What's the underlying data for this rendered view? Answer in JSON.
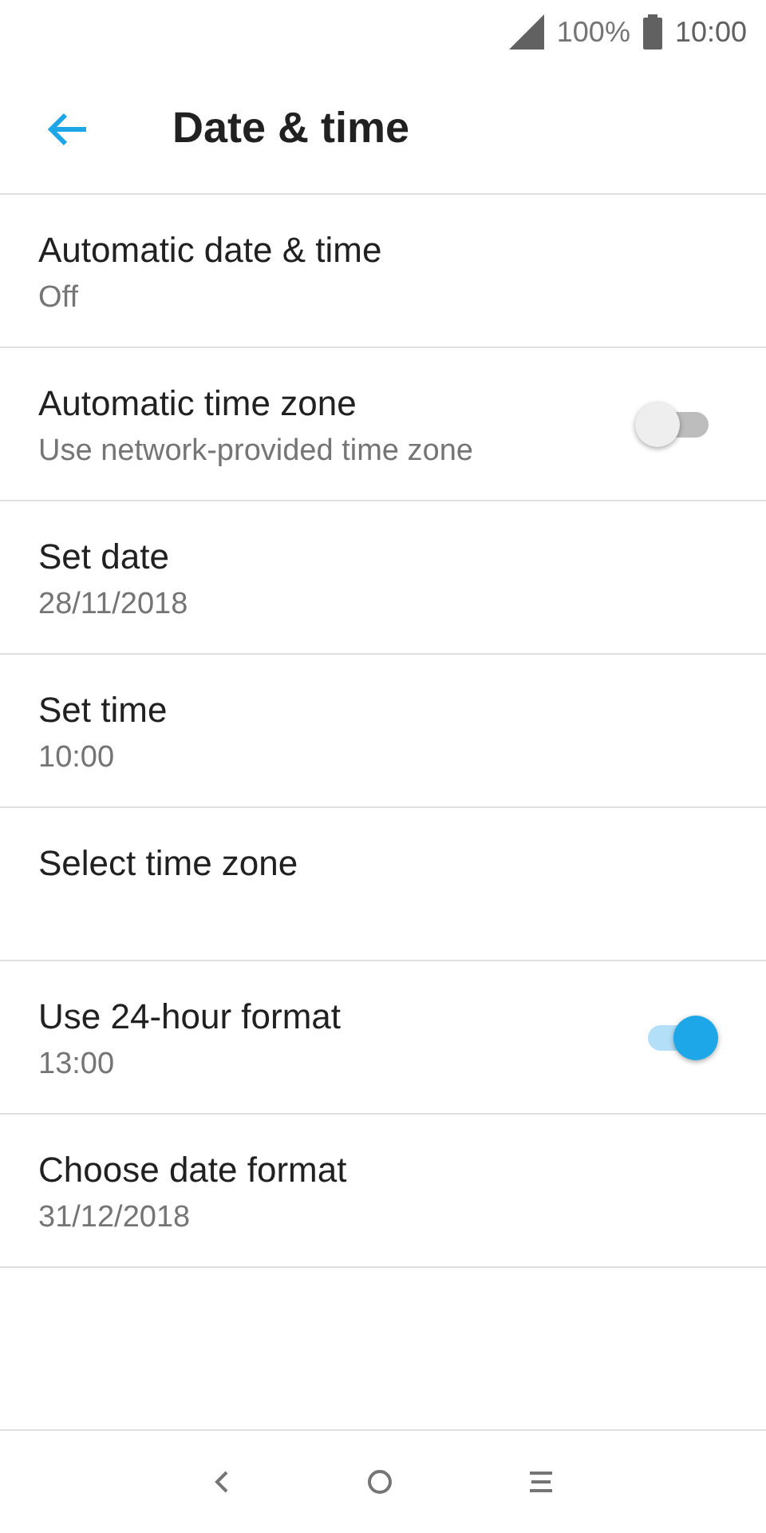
{
  "status_bar": {
    "battery": "100%",
    "time": "10:00"
  },
  "app_bar": {
    "title": "Date & time"
  },
  "settings": [
    {
      "kind": "plain",
      "title": "Automatic date & time",
      "summary": "Off"
    },
    {
      "kind": "switch",
      "title": "Automatic time zone",
      "summary": "Use network-provided time zone",
      "on": false
    },
    {
      "kind": "plain",
      "title": "Set date",
      "summary": "28/11/2018"
    },
    {
      "kind": "plain",
      "title": "Set time",
      "summary": "10:00"
    },
    {
      "kind": "plain",
      "title": "Select time zone"
    },
    {
      "kind": "switch",
      "title": "Use 24-hour format",
      "summary": "13:00",
      "on": true
    },
    {
      "kind": "plain",
      "title": "Choose date format",
      "summary": "31/12/2018"
    }
  ]
}
